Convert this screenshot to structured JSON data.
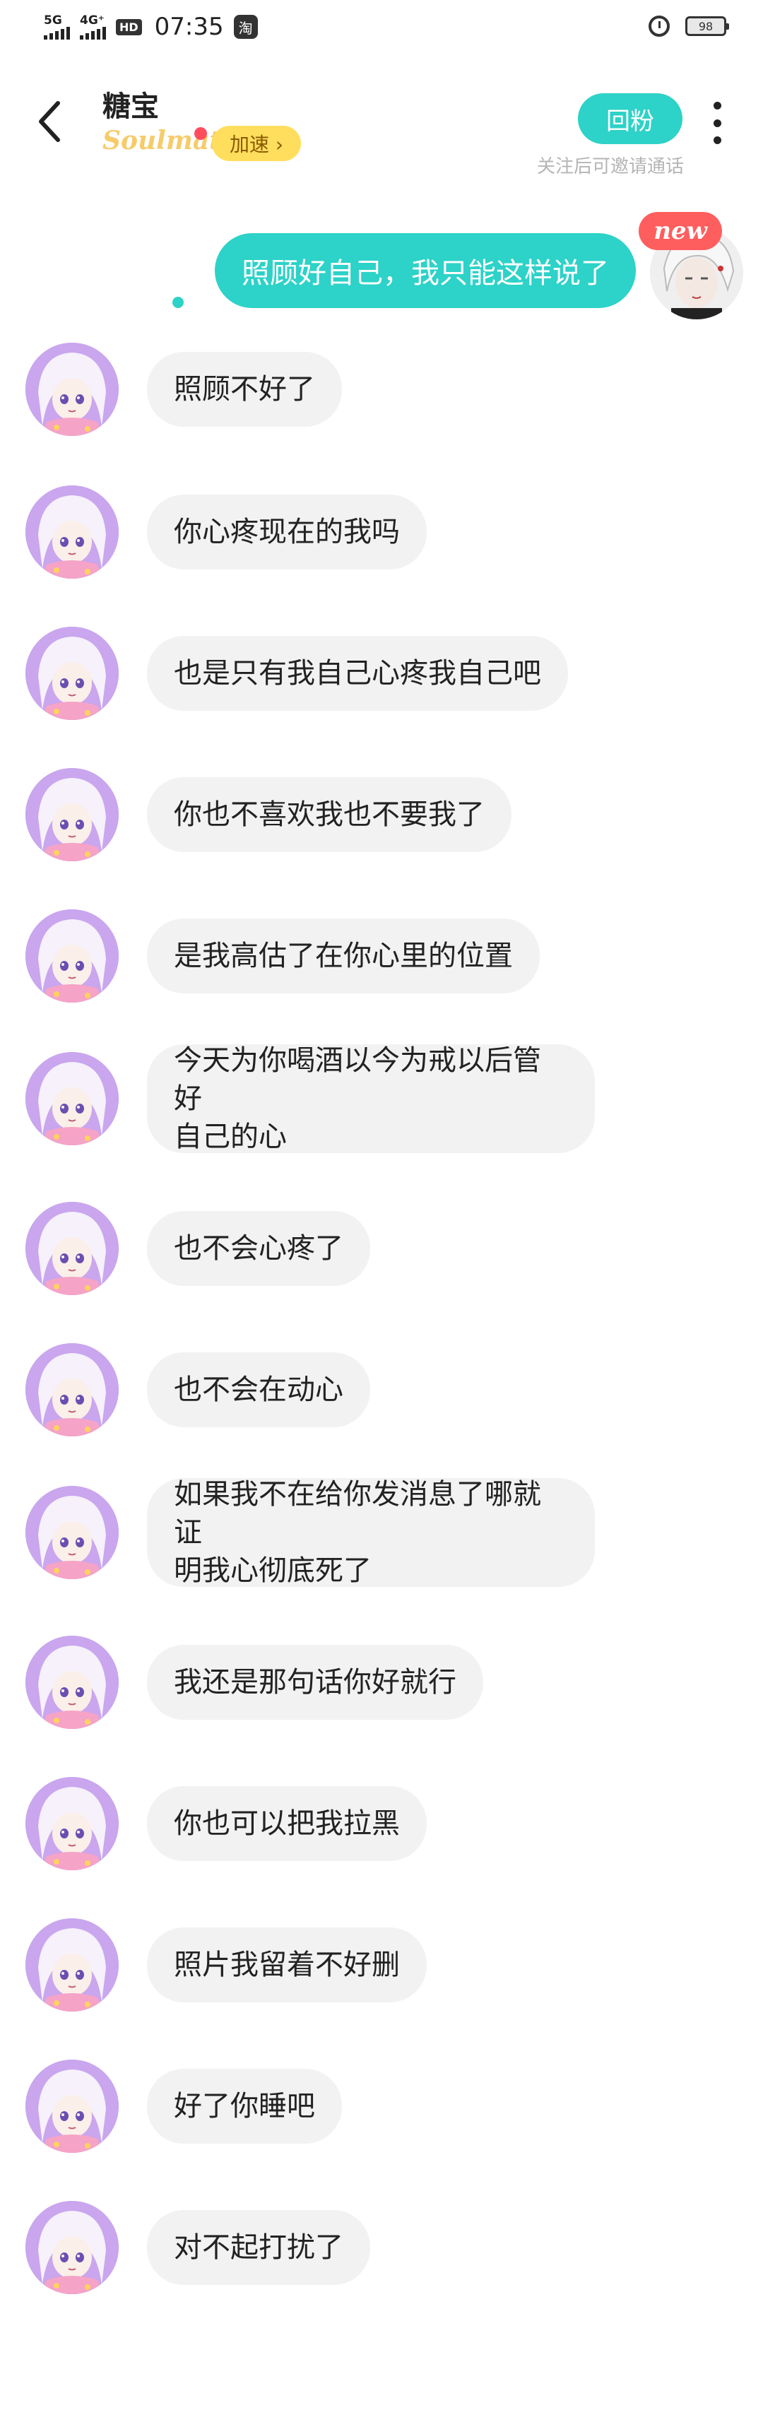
{
  "status_bar": {
    "net1": "5G",
    "net2": "4G⁺",
    "hd": "HD",
    "time": "07:35",
    "app_icon": "淘",
    "battery": "98",
    "icons": [
      "signal-icon",
      "hd-icon",
      "taobao-icon",
      "alarm-icon",
      "battery-icon"
    ]
  },
  "header": {
    "title": "糖宝",
    "soulmate": "Soulmate",
    "speed_label": "加速 ›",
    "follow_button": "回粉",
    "follow_hint": "关注后可邀请通话",
    "icons": [
      "back-icon",
      "more-icon"
    ]
  },
  "my_message": {
    "text": "照顾好自己，我只能这样说了",
    "badge": "new"
  },
  "messages": [
    {
      "text": "照顾不好了"
    },
    {
      "text": "你心疼现在的我吗"
    },
    {
      "text": "也是只有我自己心疼我自己吧"
    },
    {
      "text": "你也不喜欢我也不要我了"
    },
    {
      "text": "是我高估了在你心里的位置"
    },
    {
      "line1": "今天为你喝酒以今为戒以后管好",
      "line2": "自己的心"
    },
    {
      "text": "也不会心疼了"
    },
    {
      "text": "也不会在动心"
    },
    {
      "line1": "如果我不在给你发消息了哪就证",
      "line2": "明我心彻底死了"
    },
    {
      "text": "我还是那句话你好就行"
    },
    {
      "text": "你也可以把我拉黑"
    },
    {
      "text": "照片我留着不好删"
    },
    {
      "text": "好了你睡吧"
    },
    {
      "text": "对不起打扰了"
    }
  ],
  "colors": {
    "accent": "#2dd2c8",
    "bubble_in": "#f2f2f2",
    "badge_new": "#ff5e5e",
    "speed_badge": "#ffde5e",
    "avatar_bg": "#c7a8e8"
  }
}
